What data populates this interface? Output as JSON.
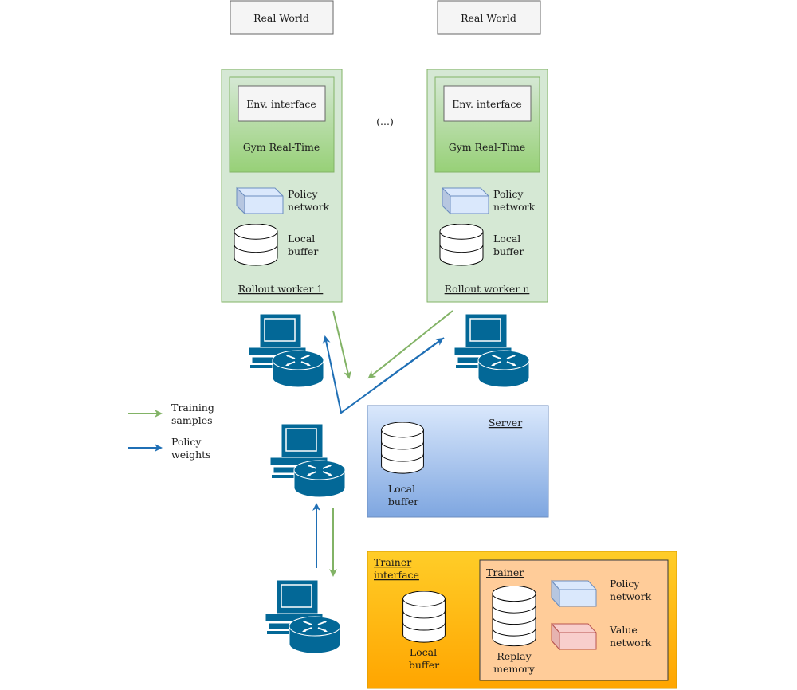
{
  "real_world": [
    "Real World",
    "Real World"
  ],
  "ellipsis": "(...)",
  "workers": [
    {
      "env_interface": "Env. interface",
      "gym": "Gym Real-Time",
      "policy": [
        "Policy",
        "network"
      ],
      "buffer": [
        "Local",
        "buffer"
      ],
      "title": "Rollout worker 1"
    },
    {
      "env_interface": "Env. interface",
      "gym": "Gym Real-Time",
      "policy": [
        "Policy",
        "network"
      ],
      "buffer": [
        "Local",
        "buffer"
      ],
      "title": "Rollout worker n"
    }
  ],
  "legend": {
    "training": [
      "Training",
      "samples"
    ],
    "policy": [
      "Policy",
      "weights"
    ]
  },
  "server": {
    "title": "Server",
    "buffer": [
      "Local",
      "buffer"
    ]
  },
  "trainer_interface": {
    "title": [
      "Trainer",
      "interface"
    ],
    "buffer": [
      "Local",
      "buffer"
    ]
  },
  "trainer": {
    "title": "Trainer",
    "replay": [
      "Replay",
      "memory"
    ],
    "policy": [
      "Policy",
      "network"
    ],
    "value": [
      "Value",
      "network"
    ]
  },
  "colors": {
    "training_arrow": "#82b366",
    "policy_arrow": "#1f6fb5",
    "worker_bg": "#d5e8d4",
    "server_top": "#dae8fc",
    "server_bottom": "#7ea6e0",
    "trainer_iface_top": "#ffcd28",
    "trainer_iface_bottom": "#ffa500",
    "trainer_bg": "#ffcc99",
    "computer": "#036897"
  }
}
